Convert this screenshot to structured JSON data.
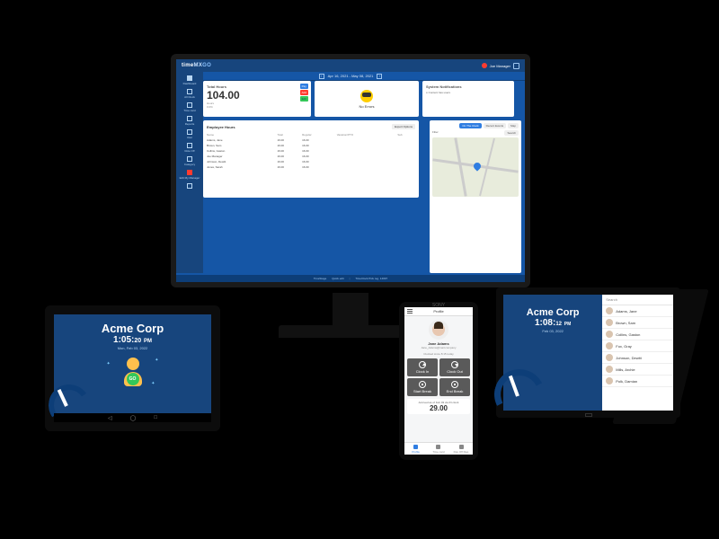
{
  "monitor": {
    "logo_a": "time",
    "logo_b": "MX",
    "logo_c": "GO",
    "user": "Joe Manager",
    "sidebar": [
      {
        "label": "Dashboard",
        "icon": "grid"
      },
      {
        "label": "All Clock",
        "icon": "clock"
      },
      {
        "label": "Time card",
        "icon": "card"
      },
      {
        "label": "Reports",
        "icon": "file"
      },
      {
        "label": "User",
        "icon": "user"
      },
      {
        "label": "Role Off",
        "icon": "role"
      },
      {
        "label": "Category",
        "icon": "tag"
      },
      {
        "label": "Edit My Manager",
        "icon": "edit",
        "red": true
      },
      {
        "label": "",
        "icon": "dots"
      }
    ],
    "daterange": "Apr 16, 2021 - May 08, 2021",
    "hours_card": {
      "title": "Total Hours",
      "value": "104.00",
      "sub": "Hours",
      "sub2": "0.0%",
      "pill1": "Pay",
      "pill2": "Add",
      "pill3": "Edit"
    },
    "mood_card": {
      "label": "No Errors"
    },
    "notif_card": {
      "title": "System Notifications",
      "items": [
        "Content has users"
      ]
    },
    "emp_table": {
      "title": "Employee Hours",
      "export": "Export Options",
      "cols": [
        "Name",
        "Total",
        "Regular",
        "Vacation/PTO",
        "Sub"
      ],
      "rows": [
        [
          "Adams, Jane",
          "16.00",
          "16.00",
          "",
          ""
        ],
        [
          "Brown, Sam",
          "16.00",
          "16.00",
          "",
          ""
        ],
        [
          "Collins, Gaston",
          "16.00",
          "16.00",
          "",
          ""
        ],
        [
          "Joe Manager",
          "16.00",
          "16.00",
          "",
          ""
        ],
        [
          "Johnson, Dewitt",
          "16.00",
          "16.00",
          "",
          ""
        ],
        [
          "Jones, Sarah",
          "16.00",
          "16.00",
          "",
          ""
        ]
      ]
    },
    "map": {
      "tab1": "On The Clock",
      "tab2": "Recent Events",
      "tab3": "Map",
      "filter": "Filter",
      "search": "Search"
    },
    "footer": {
      "a": "TimeStage",
      "b": "Quick edit",
      "c": "TimeClock Pick reg. 14097"
    }
  },
  "tablet_left": {
    "company": "Acme Corp",
    "time": "1:05:",
    "sec": "20",
    "ampm": "PM",
    "date": "Mon, Feb 03, 2022",
    "go": "GO"
  },
  "phone": {
    "brand": "SONY",
    "title": "Profile",
    "name": "Jane Adams",
    "status": "Jane_Adams@mail.company",
    "sub": "Clocked since 8:15 today",
    "btns": [
      "Clock In",
      "Clock Out",
      "Start Break",
      "End Break"
    ],
    "acc_label": "Accrued as of Feb 03 via IN clock",
    "acc_num": "29.00",
    "nav": [
      "Profile",
      "Time card",
      "Day Off Req."
    ]
  },
  "tablet_right": {
    "company": "Acme Corp",
    "time": "1:08:",
    "sec": "12",
    "ampm": "PM",
    "date": "Feb 03, 2022",
    "search": "Search",
    "employees": [
      "Adams, Jane",
      "Brown, Sam",
      "Collins, Gaston",
      "Fox, Gray",
      "Johnson, Dewitt",
      "Mills, Archie",
      "Polk, Damian"
    ]
  }
}
